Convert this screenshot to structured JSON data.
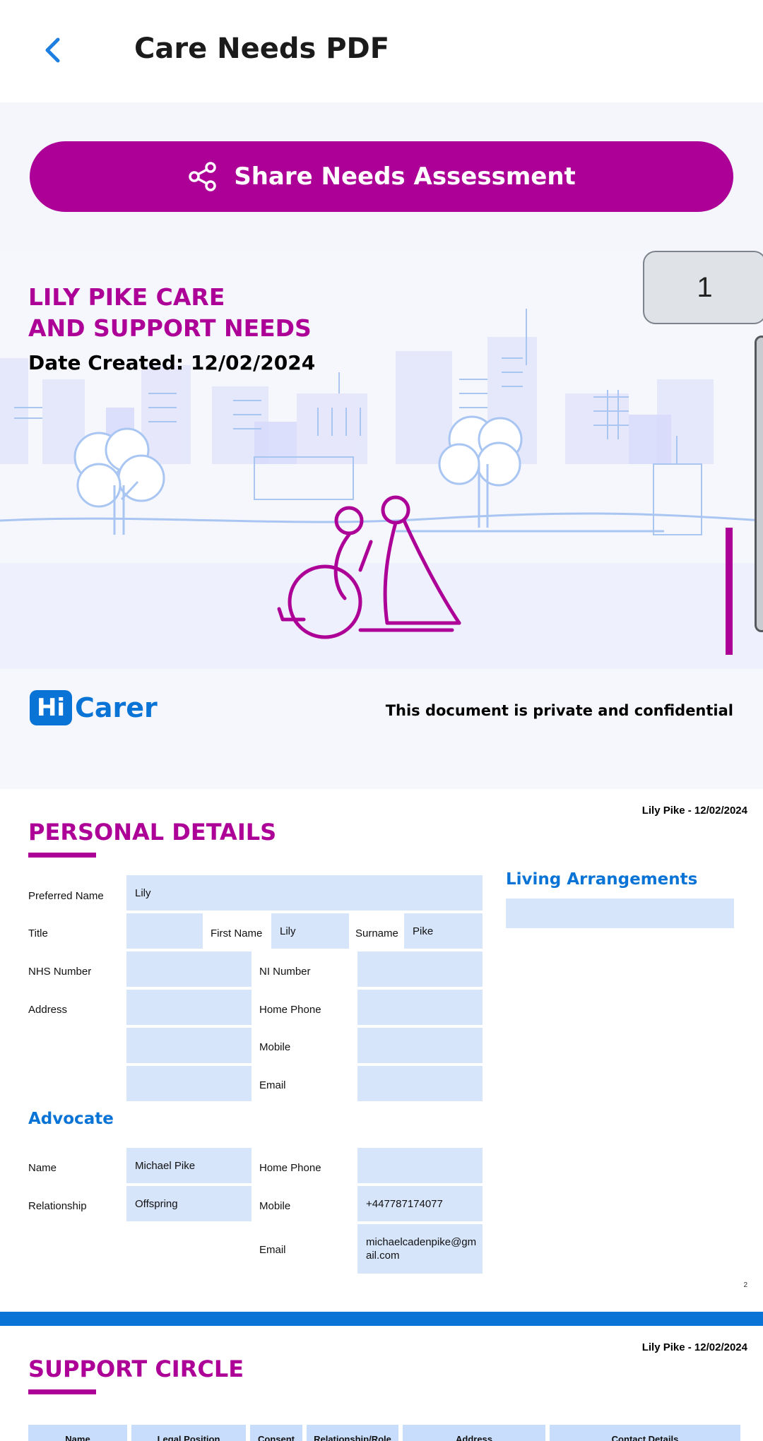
{
  "header": {
    "title": "Care Needs PDF"
  },
  "share_button": {
    "label": "Share Needs Assessment"
  },
  "page_indicator": "1",
  "cover": {
    "title_line1": "LILY PIKE CARE",
    "title_line2": "AND SUPPORT NEEDS",
    "date_created": "Date Created: 12/02/2024",
    "logo_hi": "Hi",
    "logo_carer": "Carer",
    "confidential": "This document is private and confidential"
  },
  "personal_page": {
    "header_right": "Lily Pike - 12/02/2024",
    "section_title": "PERSONAL DETAILS",
    "labels": {
      "preferred_name": "Preferred Name",
      "title": "Title",
      "first_name": "First Name",
      "surname": "Surname",
      "nhs_number": "NHS Number",
      "ni_number": "NI Number",
      "address": "Address",
      "home_phone": "Home Phone",
      "mobile": "Mobile",
      "email": "Email"
    },
    "values": {
      "preferred_name": "Lily",
      "title": "",
      "first_name": "Lily",
      "surname": "Pike",
      "nhs_number": "",
      "ni_number": "",
      "address": "",
      "home_phone": "",
      "mobile": "",
      "email": ""
    },
    "living_title": "Living Arrangements",
    "living_value": "",
    "advocate_title": "Advocate",
    "advocate": {
      "name_label": "Name",
      "name": "Michael Pike",
      "relationship_label": "Relationship",
      "relationship": "Offspring",
      "home_phone_label": "Home Phone",
      "home_phone": "",
      "mobile_label": "Mobile",
      "mobile": "+447787174077",
      "email_label": "Email",
      "email": "michaelcadenpike@gmail.com"
    },
    "page_number": "2"
  },
  "support_page": {
    "header_right": "Lily Pike - 12/02/2024",
    "section_title": "SUPPORT CIRCLE",
    "columns": [
      "Name",
      "Legal Position",
      "Consent",
      "Relationship/Role",
      "Address",
      "Contact Details"
    ]
  },
  "colors": {
    "brand_magenta": "#ac0097",
    "brand_blue": "#0a74d6",
    "cell_fill": "#d7e5fb"
  }
}
